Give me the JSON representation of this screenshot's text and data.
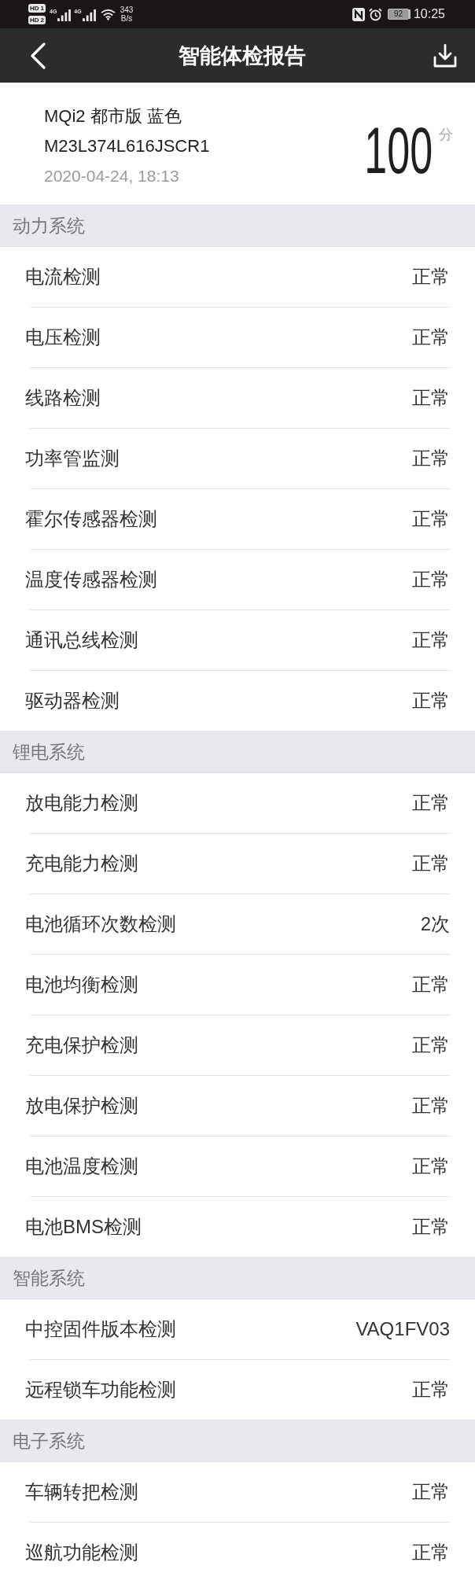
{
  "status_bar": {
    "sims": [
      {
        "badge": "HD",
        "slot": "1",
        "network": "4G"
      },
      {
        "badge": "HD",
        "slot": "2",
        "network": "4G"
      }
    ],
    "speed_value": "343",
    "speed_unit": "B/s",
    "battery": "92",
    "time": "10:25"
  },
  "header": {
    "title": "智能体检报告"
  },
  "vehicle": {
    "model": "MQi2 都市版 蓝色",
    "serial": "M23L374L616JSCR1",
    "timestamp": "2020-04-24, 18:13",
    "score": "100",
    "score_unit": "分"
  },
  "sections": [
    {
      "title": "动力系统",
      "items": [
        {
          "name": "电流检测",
          "result": "正常"
        },
        {
          "name": "电压检测",
          "result": "正常"
        },
        {
          "name": "线路检测",
          "result": "正常"
        },
        {
          "name": "功率管监测",
          "result": "正常"
        },
        {
          "name": "霍尔传感器检测",
          "result": "正常"
        },
        {
          "name": "温度传感器检测",
          "result": "正常"
        },
        {
          "name": "通讯总线检测",
          "result": "正常"
        },
        {
          "name": "驱动器检测",
          "result": "正常"
        }
      ]
    },
    {
      "title": "锂电系统",
      "items": [
        {
          "name": "放电能力检测",
          "result": "正常"
        },
        {
          "name": "充电能力检测",
          "result": "正常"
        },
        {
          "name": "电池循环次数检测",
          "result": "2次"
        },
        {
          "name": "电池均衡检测",
          "result": "正常"
        },
        {
          "name": "充电保护检测",
          "result": "正常"
        },
        {
          "name": "放电保护检测",
          "result": "正常"
        },
        {
          "name": "电池温度检测",
          "result": "正常"
        },
        {
          "name": "电池BMS检测",
          "result": "正常"
        }
      ]
    },
    {
      "title": "智能系统",
      "items": [
        {
          "name": "中控固件版本检测",
          "result": "VAQ1FV03"
        },
        {
          "name": "远程锁车功能检测",
          "result": "正常"
        }
      ]
    },
    {
      "title": "电子系统",
      "items": [
        {
          "name": "车辆转把检测",
          "result": "正常"
        },
        {
          "name": "巡航功能检测",
          "result": "正常"
        }
      ]
    }
  ]
}
